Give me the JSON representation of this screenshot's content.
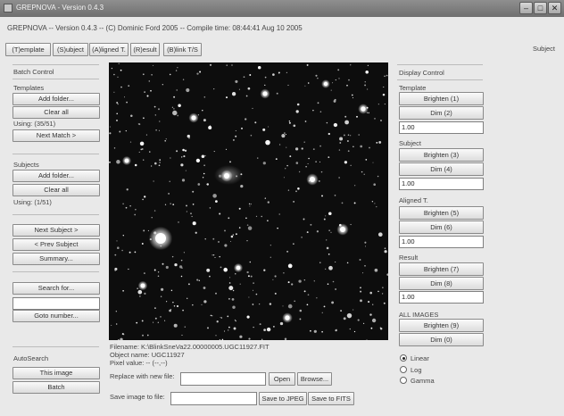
{
  "window": {
    "title": "GREPNOVA - Version 0.4.3"
  },
  "header": {
    "subtitle": "GREPNOVA -- Version 0.4.3 -- (C) Dominic Ford 2005 -- Compile time: 08:44:41 Aug 10 2005"
  },
  "toolbar": {
    "tabs": [
      "(T)emplate",
      "(S)ubject",
      "(A)ligned T.",
      "(R)esult",
      "(B)link T/S"
    ],
    "mode_label": "Subject"
  },
  "left": {
    "batch_title": "Batch Control",
    "templates_label": "Templates",
    "add_folder": "Add folder...",
    "clear_all": "Clear all",
    "templates_using": "Using: (35/51)",
    "next_match": "Next Match >",
    "subjects_label": "Subjects",
    "subjects_using": "Using: (1/51)",
    "next_subject": "Next Subject >",
    "prev_subject": "< Prev Subject",
    "summary": "Summary...",
    "search_for": "Search for...",
    "search_value": "",
    "goto_number": "Goto number...",
    "autosearch_label": "AutoSearch",
    "this_image": "This image",
    "batch": "Batch"
  },
  "center": {
    "filename": "Filename: K:\\BlinkSneVa22.00000005.UGC11927.FIT",
    "object_name": "Object name: UGC11927",
    "pixel_value": "Pixel value: -- (--,--)",
    "replace_label": "Replace with new file:",
    "replace_value": "",
    "open": "Open",
    "browse": "Browse...",
    "save_label": "Save image to file:",
    "save_value": "",
    "save_jpeg": "Save to JPEG",
    "save_fits": "Save to FITS"
  },
  "right": {
    "display_title": "Display Control",
    "template_label": "Template",
    "brighten_1": "Brighten (1)",
    "dim_2": "Dim (2)",
    "template_value": "1.00",
    "subject_label": "Subject",
    "brighten_3": "Brighten (3)",
    "dim_4": "Dim (4)",
    "subject_value": "1.00",
    "aligned_label": "Aligned T.",
    "brighten_5": "Brighten (5)",
    "dim_6": "Dim (6)",
    "aligned_value": "1.00",
    "result_label": "Result",
    "brighten_7": "Brighten (7)",
    "dim_8": "Dim (8)",
    "result_value": "1.00",
    "all_label": "ALL IMAGES",
    "brighten_9": "Brighten (9)",
    "dim_0": "Dim (0)",
    "scale_options": [
      "Linear",
      "Log",
      "Gamma"
    ],
    "scale_selected": "Linear"
  }
}
